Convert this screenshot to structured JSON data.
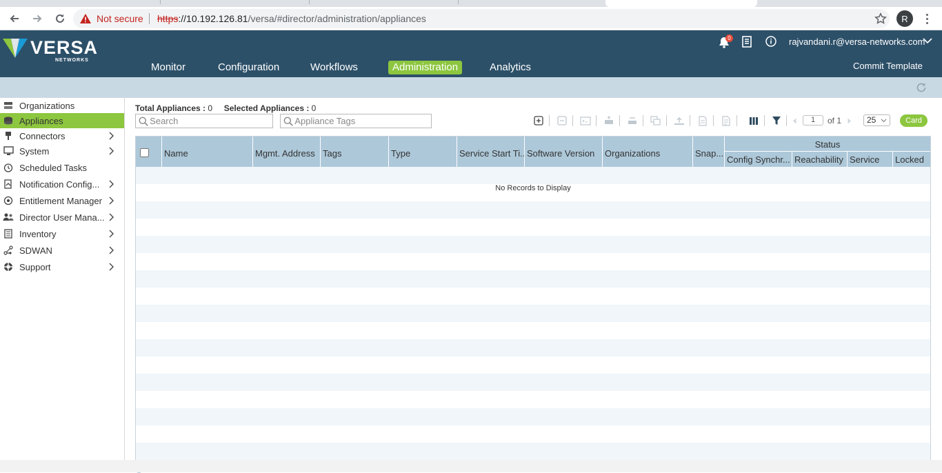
{
  "browser": {
    "security_label": "Not secure",
    "url_scheme": "https",
    "url_host": "://10.192.126.81",
    "url_path": "/versa/#director/administration/appliances",
    "profile_initial": "R"
  },
  "app": {
    "logo_text": "VERSA",
    "logo_subtext": "NETWORKS",
    "notification_count": "0",
    "user_email": "rajvandani.r@versa-networks.com",
    "commit_template_label": "Commit Template",
    "nav": [
      {
        "label": "Monitor"
      },
      {
        "label": "Configuration"
      },
      {
        "label": "Workflows"
      },
      {
        "label": "Administration"
      },
      {
        "label": "Analytics"
      }
    ],
    "active_nav": "Administration",
    "colors": {
      "header": "#2d5069",
      "accent": "#8dc63f",
      "subbar": "#c9d9e3",
      "grid_header": "#adc8d9"
    }
  },
  "sidebar": {
    "items": [
      {
        "label": "Organizations",
        "icon": "organizations-icon",
        "has_children": false
      },
      {
        "label": "Appliances",
        "icon": "appliances-icon",
        "has_children": false,
        "active": true
      },
      {
        "label": "Connectors",
        "icon": "connectors-icon",
        "has_children": true
      },
      {
        "label": "System",
        "icon": "system-icon",
        "has_children": true
      },
      {
        "label": "Scheduled Tasks",
        "icon": "scheduled-tasks-icon",
        "has_children": false
      },
      {
        "label": "Notification Config...",
        "icon": "notification-config-icon",
        "has_children": true
      },
      {
        "label": "Entitlement Manager",
        "icon": "entitlement-icon",
        "has_children": true
      },
      {
        "label": "Director User Mana...",
        "icon": "director-users-icon",
        "has_children": true
      },
      {
        "label": "Inventory",
        "icon": "inventory-icon",
        "has_children": true
      },
      {
        "label": "SDWAN",
        "icon": "sdwan-icon",
        "has_children": true
      },
      {
        "label": "Support",
        "icon": "support-icon",
        "has_children": true
      }
    ]
  },
  "summary": {
    "total_label": "Total Appliances :",
    "total_value": "0",
    "selected_label": "Selected Appliances :",
    "selected_value": "0"
  },
  "search": {
    "placeholder": "Search",
    "tags_placeholder": "Appliance Tags"
  },
  "pagination": {
    "current_page": "1",
    "of_label": "of 1",
    "page_size": "25",
    "card_label": "Card"
  },
  "grid": {
    "columns": [
      "Name",
      "Mgmt. Address",
      "Tags",
      "Type",
      "Service Start Ti...",
      "Software Version",
      "Organizations",
      "Snap..."
    ],
    "status_group_label": "Status",
    "status_columns": [
      "Config Synchr...",
      "Reachability",
      "Service",
      "Locked"
    ],
    "empty_message": "No Records to Display"
  }
}
